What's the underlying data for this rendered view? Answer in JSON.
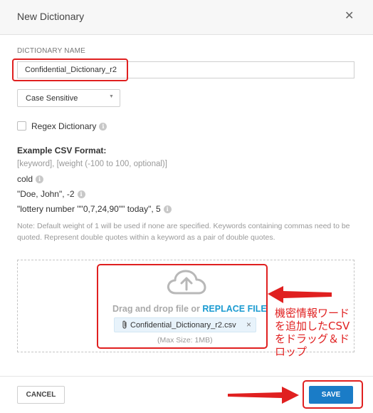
{
  "dialog": {
    "title": "New Dictionary",
    "close_glyph": "✕"
  },
  "form": {
    "name_label": "DICTIONARY NAME",
    "name_value": "Confidential_Dictionary_r2",
    "case_select": {
      "selected": "Case Sensitive",
      "caret_glyph": "▼"
    },
    "regex_label": "Regex Dictionary",
    "regex_checked": false
  },
  "csv_example": {
    "title": "Example CSV Format:",
    "hint": "[keyword], [weight (-100 to 100, optional)]",
    "lines": [
      "cold",
      "\"Doe, John\", -2",
      "\"lottery number \"\"0,7,24,90\"\" today\", 5"
    ],
    "note": "Note: Default weight of 1 will be used if none are specified. Keywords containing commas need to be quoted. Represent double quotes within a keyword as a pair of double quotes."
  },
  "upload": {
    "drag_text": "Drag and drop file or ",
    "replace_link": "REPLACE FILE",
    "file_name": "Confidential_Dictionary_r2.csv",
    "max_size": "(Max Size: 1MB)"
  },
  "annotation": {
    "lines": [
      "機密情報ワード",
      "を追加したCSV",
      "をドラッグ＆ド",
      "ロップ"
    ],
    "color": "#e02020"
  },
  "footer": {
    "cancel_label": "CANCEL",
    "save_label": "SAVE"
  },
  "colors": {
    "primary": "#1a7cc7",
    "link": "#1b9bd1",
    "highlight": "#e02020"
  },
  "icons": {
    "info": "info-icon",
    "upload": "cloud-upload-icon",
    "attachment": "paperclip-icon",
    "close": "close-icon"
  }
}
